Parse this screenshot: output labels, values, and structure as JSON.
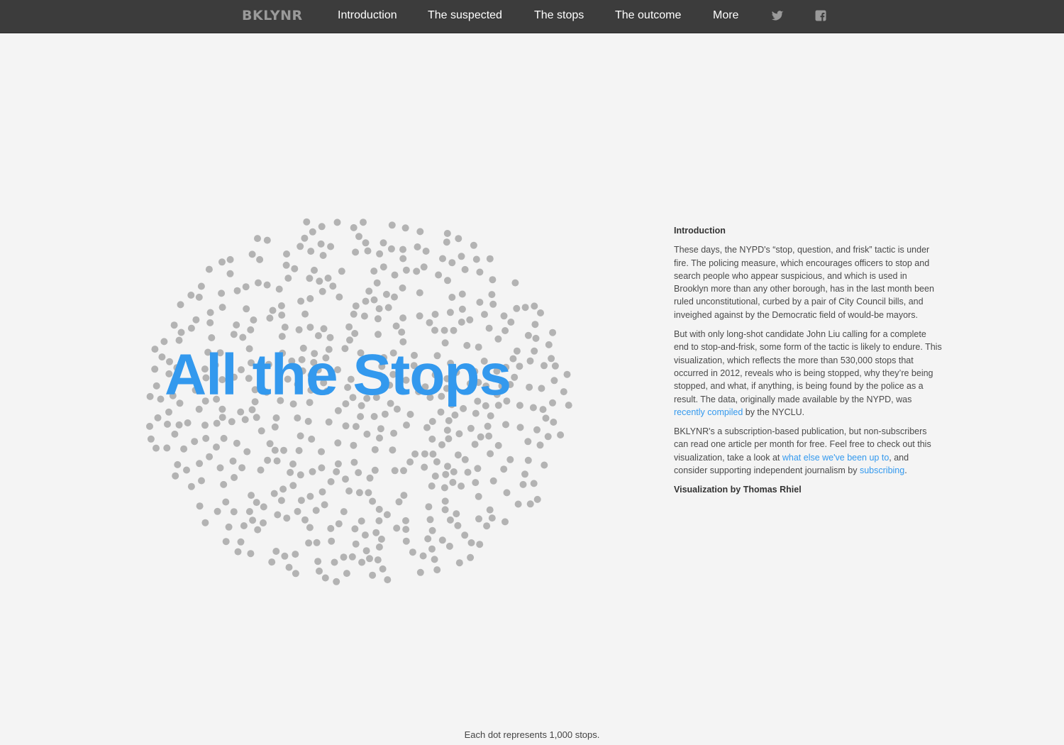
{
  "nav": {
    "brand": "BKLYNR",
    "items": [
      "Introduction",
      "The suspected",
      "The stops",
      "The outcome",
      "More"
    ],
    "icons": [
      "twitter-icon",
      "facebook-icon"
    ]
  },
  "hero": {
    "title": "All the Stops"
  },
  "intro": {
    "heading": "Introduction",
    "p1": "These days, the NYPD's “stop, question, and frisk” tactic is under fire. The policing measure, which encourages officers to stop and search people who appear suspicious, and which is used in Brooklyn more than any other borough, has in the last month been ruled unconstitutional, curbed by a pair of City Council bills, and inveighed against by the Democratic field of would-be mayors.",
    "p2_before": "But with only long-shot candidate John Liu calling for a complete end to stop-and-frisk, some form of the tactic is likely to endure. This visualization, which reflects the more than 530,000 stops that occurred in 2012, reveals who is being stopped, why they’re being stopped, and what, if anything, is being found by the police as a result. The data, originally made available by the NYPD, was ",
    "p2_link": "recently compiled",
    "p2_after": " by the NYCLU.",
    "p3_before": "BKLYNR's a subscription-based publication, but non-subscribers can read one article per month for free. Feel free to check out this visualization, take a look at ",
    "p3_link1": "what else we've been up to",
    "p3_mid": ", and consider supporting independent journalism by ",
    "p3_link2": "subscribing",
    "p3_after": ".",
    "credit": "Visualization by Thomas Rhiel"
  },
  "footer": {
    "note": "Each dot represents 1,000 stops."
  },
  "visualization": {
    "dot_count": 530,
    "dot_represents": 1000,
    "dot_color": "#b3b3b3"
  },
  "colors": {
    "accent": "#3399ee",
    "navbar": "#3c3c3c",
    "background": "#f4f4f4"
  }
}
